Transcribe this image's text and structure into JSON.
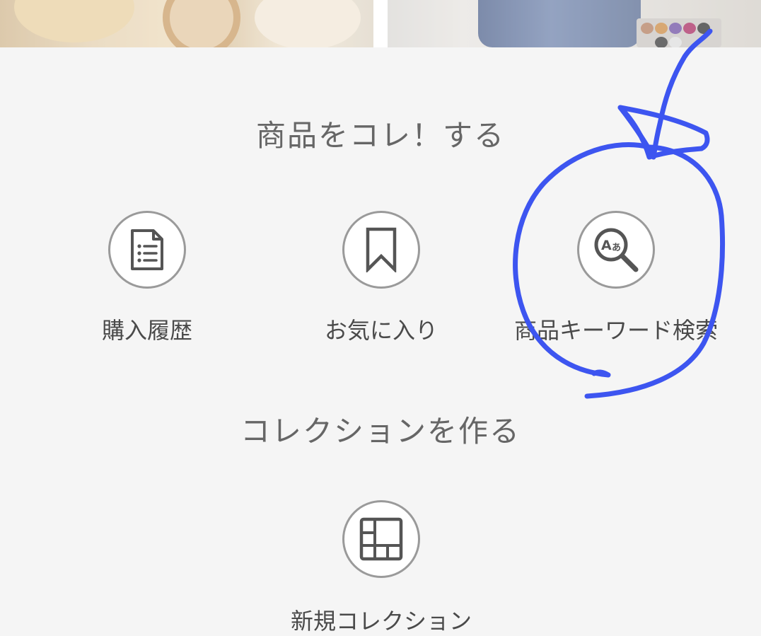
{
  "section_collect": {
    "title": "商品をコレ！する",
    "actions": [
      {
        "label": "購入履歴",
        "icon": "purchase-history-icon"
      },
      {
        "label": "お気に入り",
        "icon": "bookmark-icon"
      },
      {
        "label": "商品キーワード検索",
        "icon": "keyword-search-icon"
      }
    ]
  },
  "section_collection": {
    "title": "コレクションを作る",
    "actions": [
      {
        "label": "新規コレクション",
        "icon": "collection-grid-icon"
      }
    ]
  },
  "annotation": {
    "color": "#3d55f0",
    "marks": "circle-and-arrow-around-keyword-search"
  },
  "colors": {
    "background": "#f5f5f5",
    "icon_border": "#9a9a9a",
    "icon_stroke": "#555555",
    "label_text": "#4a4a4a",
    "title_text": "#666666"
  }
}
